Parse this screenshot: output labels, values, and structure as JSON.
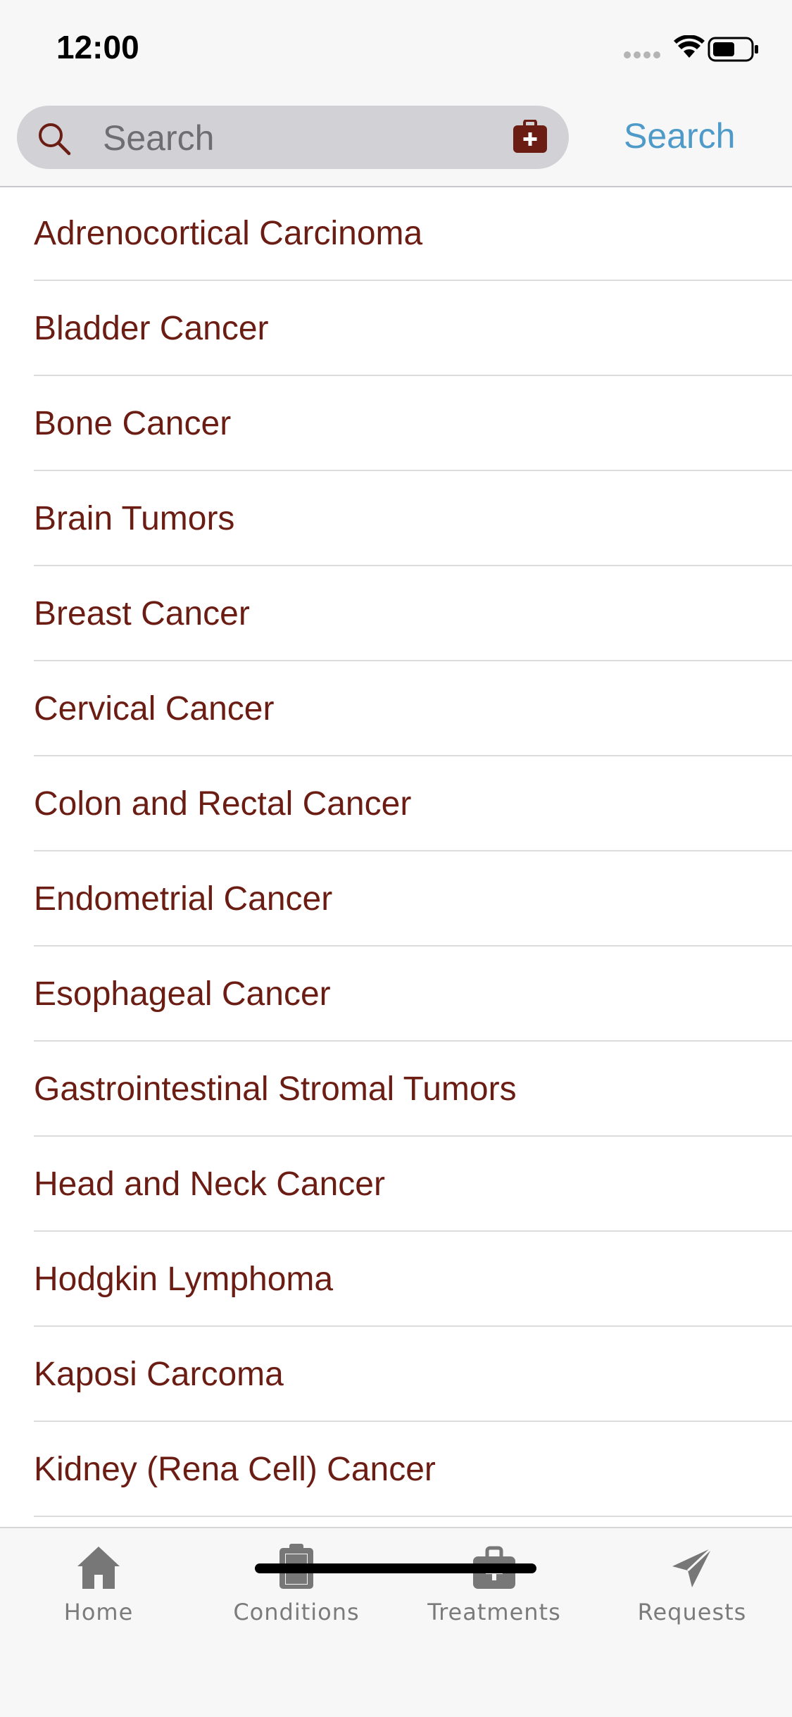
{
  "status_bar": {
    "time": "12:00"
  },
  "search": {
    "placeholder": "Search",
    "button_label": "Search",
    "accent_color": "#4e9ac9"
  },
  "conditions": [
    "Adrenocortical Carcinoma",
    "Bladder Cancer",
    "Bone Cancer",
    "Brain Tumors",
    "Breast Cancer",
    "Cervical Cancer",
    "Colon and Rectal Cancer",
    "Endometrial Cancer",
    "Esophageal Cancer",
    "Gastrointestinal Stromal Tumors",
    "Head and Neck Cancer",
    "Hodgkin Lymphoma",
    "Kaposi Carcoma",
    "Kidney (Rena Cell) Cancer"
  ],
  "list_text_color": "#6b1d14",
  "tab_bar": {
    "tabs": [
      {
        "label": "Home",
        "icon": "home-icon"
      },
      {
        "label": "Conditions",
        "icon": "clipboard-icon"
      },
      {
        "label": "Treatments",
        "icon": "medical-briefcase-icon"
      },
      {
        "label": "Requests",
        "icon": "paper-plane-icon"
      }
    ]
  }
}
